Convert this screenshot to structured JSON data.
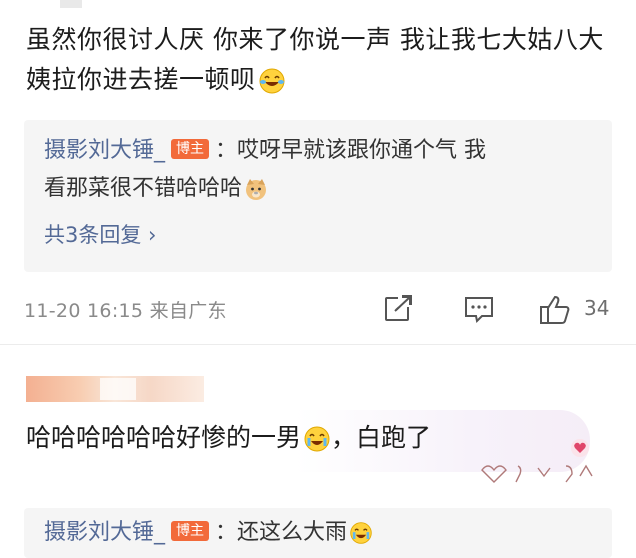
{
  "comment": {
    "text": "虽然你很讨人厌 你来了你说一声 我让我七大姑八大姨拉你进去搓一顿呗",
    "emoji": "laugh-cry-emoji",
    "replies": {
      "user": "摄影刘大锤_",
      "badge": "博主",
      "separator": "：",
      "text_line1": "哎呀早就该跟你通个气 我",
      "text_line2": "看那菜很不错哈哈哈",
      "emoji": "doge-emoji",
      "more_label": "共3条回复 ›"
    },
    "timestamp": "11-20 16:15",
    "location": "来自广东",
    "like_count": "34"
  },
  "comment2": {
    "text_before_emoji": "哈哈哈哈哈哈好惨的一男",
    "text_after_emoji": "，白跑了",
    "reply": {
      "user": "摄影刘大锤_",
      "badge": "博主",
      "separator": "：",
      "text": "还这么大雨"
    }
  },
  "colors": {
    "link": "#536996",
    "badge": "#f26a3a",
    "muted": "#8a8a8a",
    "reply_bg": "#f5f5f5"
  }
}
